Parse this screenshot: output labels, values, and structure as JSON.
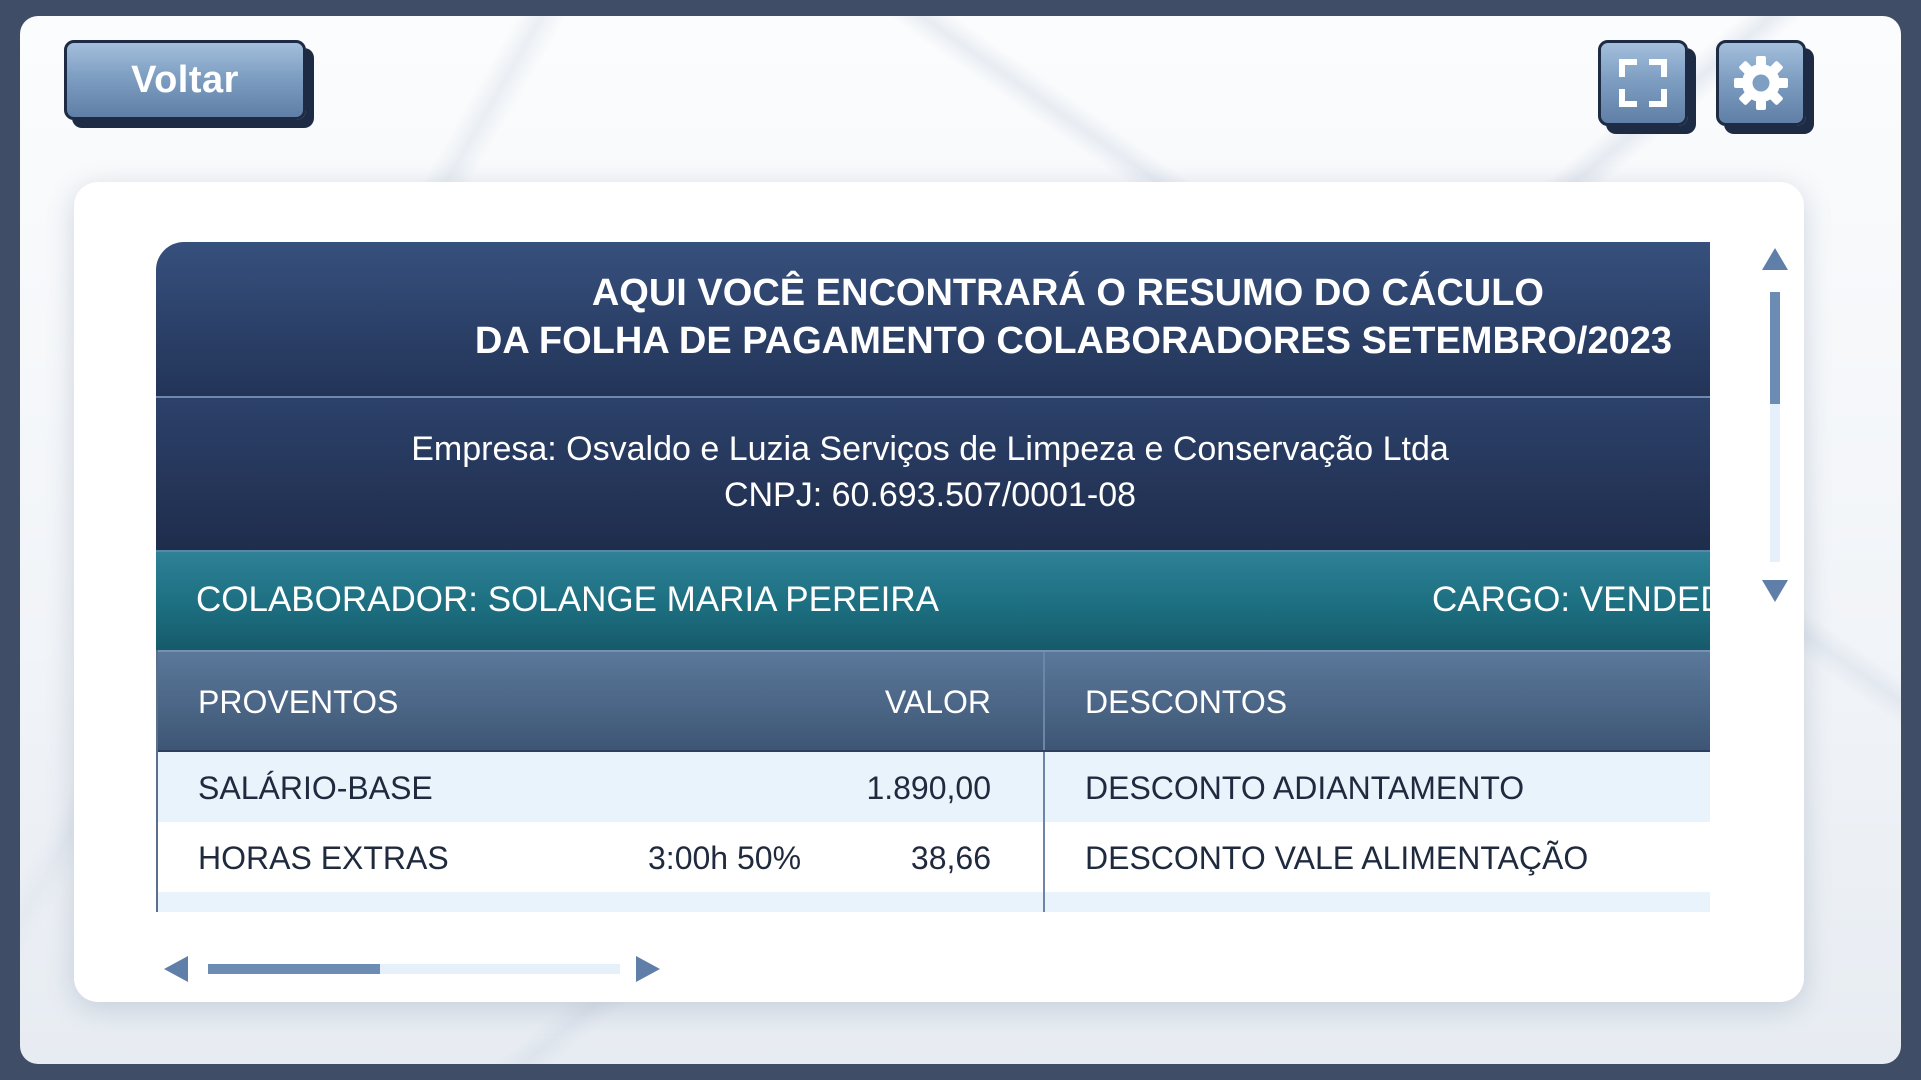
{
  "toolbar": {
    "back_label": "Voltar",
    "fullscreen_icon": "fullscreen-icon",
    "settings_icon": "gear-icon"
  },
  "report": {
    "title_line1": "AQUI VOCÊ ENCONTRARÁ O RESUMO DO CÁCULO",
    "title_line2": "DA FOLHA DE PAGAMENTO COLABORADORES SETEMBRO/2023",
    "company": "Empresa: Osvaldo e Luzia Serviços de Limpeza e Conservação Ltda",
    "cnpj": "CNPJ: 60.693.507/0001-08",
    "collaborator": "COLABORADOR: SOLANGE MARIA PEREIRA",
    "cargo": "CARGO: VENDEDORA"
  },
  "table": {
    "headers": {
      "proventos": "PROVENTOS",
      "valor": "VALOR",
      "descontos": "DESCONTOS"
    },
    "rows": [
      {
        "provento": "SALÁRIO-BASE",
        "ref": "",
        "valor": "1.890,00",
        "desconto": "DESCONTO ADIANTAMENTO"
      },
      {
        "provento": "HORAS EXTRAS",
        "ref": "3:00h 50%",
        "valor": "38,66",
        "desconto": "DESCONTO VALE ALIMENTAÇÃO"
      }
    ]
  },
  "colors": {
    "header_navy": "#233458",
    "teal_band": "#1c6f80",
    "button_blue": "#7e9ec2",
    "row_alt": "#e8f3fc"
  }
}
